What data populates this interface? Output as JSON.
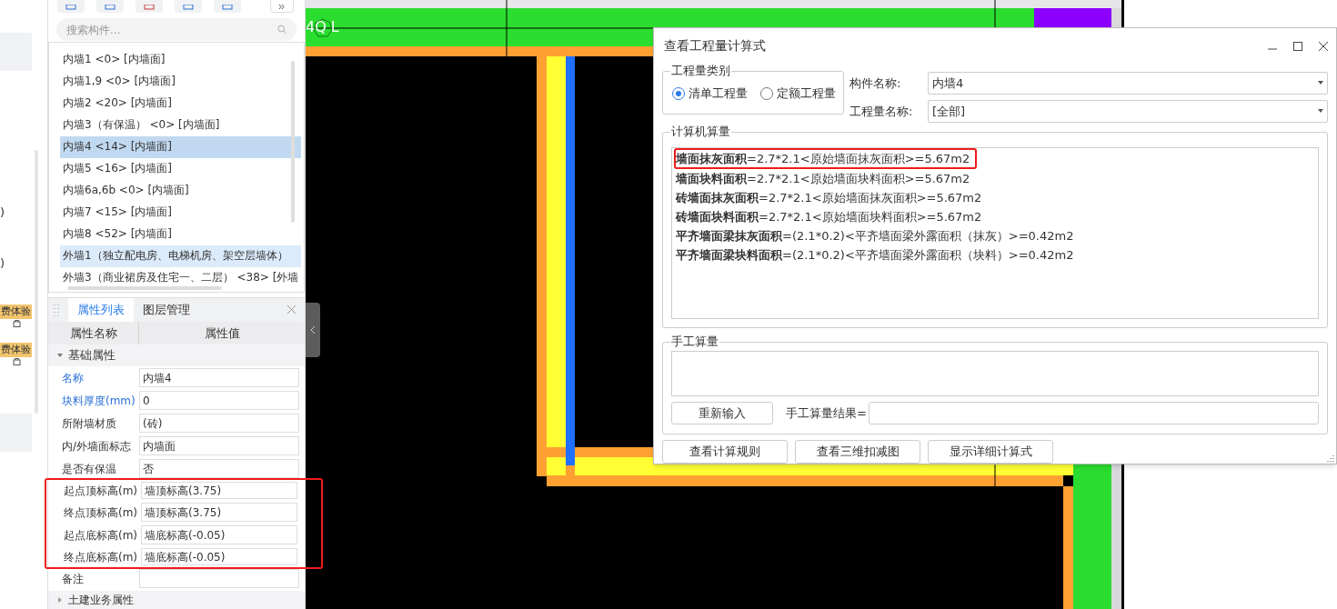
{
  "left_strip": {
    "marks": [
      ")",
      ")"
    ],
    "badges": [
      "费体验",
      "费体验"
    ]
  },
  "component_panel": {
    "search": {
      "placeholder": "搜索构件..."
    },
    "items": [
      {
        "label": "内墙1 <0> [内墙面]",
        "selected": false,
        "hovered": false
      },
      {
        "label": "内墙1,9 <0> [内墙面]",
        "selected": false,
        "hovered": false
      },
      {
        "label": "内墙2 <20> [内墙面]",
        "selected": false,
        "hovered": false
      },
      {
        "label": "内墙3（有保温） <0> [内墙面]",
        "selected": false,
        "hovered": false
      },
      {
        "label": "内墙4 <14> [内墙面]",
        "selected": true,
        "hovered": false
      },
      {
        "label": "内墙5 <16> [内墙面]",
        "selected": false,
        "hovered": false
      },
      {
        "label": "内墙6a,6b <0> [内墙面]",
        "selected": false,
        "hovered": false
      },
      {
        "label": "内墙7 <15> [内墙面]",
        "selected": false,
        "hovered": false
      },
      {
        "label": "内墙8 <52> [内墙面]",
        "selected": false,
        "hovered": false
      },
      {
        "label": "外墙1（独立配电房、电梯机房、架空层墙体）",
        "selected": false,
        "hovered": true
      },
      {
        "label": "外墙3（商业裙房及住宅一、二层） <38> [外墙",
        "selected": false,
        "hovered": false
      }
    ]
  },
  "properties": {
    "tabs": [
      {
        "label": "属性列表",
        "selected": true
      },
      {
        "label": "图层管理",
        "selected": false
      }
    ],
    "columns": [
      "属性名称",
      "属性值"
    ],
    "group": {
      "label": "基础属性",
      "expanded": true
    },
    "rows": [
      {
        "name": "名称",
        "value": "内墙4",
        "linked": true,
        "highlighted": false
      },
      {
        "name": "块料厚度(mm)",
        "value": "0",
        "linked": true,
        "highlighted": false
      },
      {
        "name": "所附墙材质",
        "value": "(砖)",
        "linked": false,
        "highlighted": false
      },
      {
        "name": "内/外墙面标志",
        "value": "内墙面",
        "linked": false,
        "highlighted": false
      },
      {
        "name": "是否有保温",
        "value": "否",
        "linked": false,
        "highlighted": false
      },
      {
        "name": "起点顶标高(m)",
        "value": "墙顶标高(3.75)",
        "linked": false,
        "highlighted": true
      },
      {
        "name": "终点顶标高(m)",
        "value": "墙顶标高(3.75)",
        "linked": false,
        "highlighted": true
      },
      {
        "name": "起点底标高(m)",
        "value": "墙底标高(-0.05)",
        "linked": false,
        "highlighted": true
      },
      {
        "name": "终点底标高(m)",
        "value": "墙底标高(-0.05)",
        "linked": false,
        "highlighted": true
      },
      {
        "name": "备注",
        "value": "",
        "linked": false,
        "highlighted": false
      }
    ],
    "next_group": {
      "label": "土建业务属性",
      "expanded": false
    }
  },
  "canvas": {
    "axis_label": "4Q L"
  },
  "dialog": {
    "title": "查看工程量计算式",
    "category": {
      "legend": "工程量类别",
      "options": [
        {
          "label": "清单工程量",
          "selected": true
        },
        {
          "label": "定额工程量",
          "selected": false
        }
      ]
    },
    "fields": [
      {
        "label": "构件名称:",
        "value": "内墙4"
      },
      {
        "label": "工程量名称:",
        "value": "[全部]"
      }
    ],
    "computed": {
      "legend": "计算机算量",
      "lines": [
        {
          "text": "**墙面抹灰面积**=2.7*2.1<原始墙面抹灰面积>=5.67m2",
          "highlighted": true
        },
        {
          "text": "**墙面块料面积**=2.7*2.1<原始墙面块料面积>=5.67m2",
          "highlighted": false
        },
        {
          "text": "**砖墙面抹灰面积**=2.7*2.1<原始墙面抹灰面积>=5.67m2",
          "highlighted": false
        },
        {
          "text": "**砖墙面块料面积**=2.7*2.1<原始墙面块料面积>=5.67m2",
          "highlighted": false
        },
        {
          "text": "**平齐墙面梁抹灰面积**=(2.1*0.2)<平齐墙面梁外露面积（抹灰）>=0.42m2",
          "highlighted": false
        },
        {
          "text": "**平齐墙面梁块料面积**=(2.1*0.2)<平齐墙面梁外露面积（块料）>=0.42m2",
          "highlighted": false
        }
      ]
    },
    "manual": {
      "legend": "手工算量",
      "reset_button": "重新输入",
      "result_label": "手工算量结果="
    },
    "buttons": [
      "查看计算规则",
      "查看三维扣减图",
      "显示详细计算式"
    ]
  }
}
